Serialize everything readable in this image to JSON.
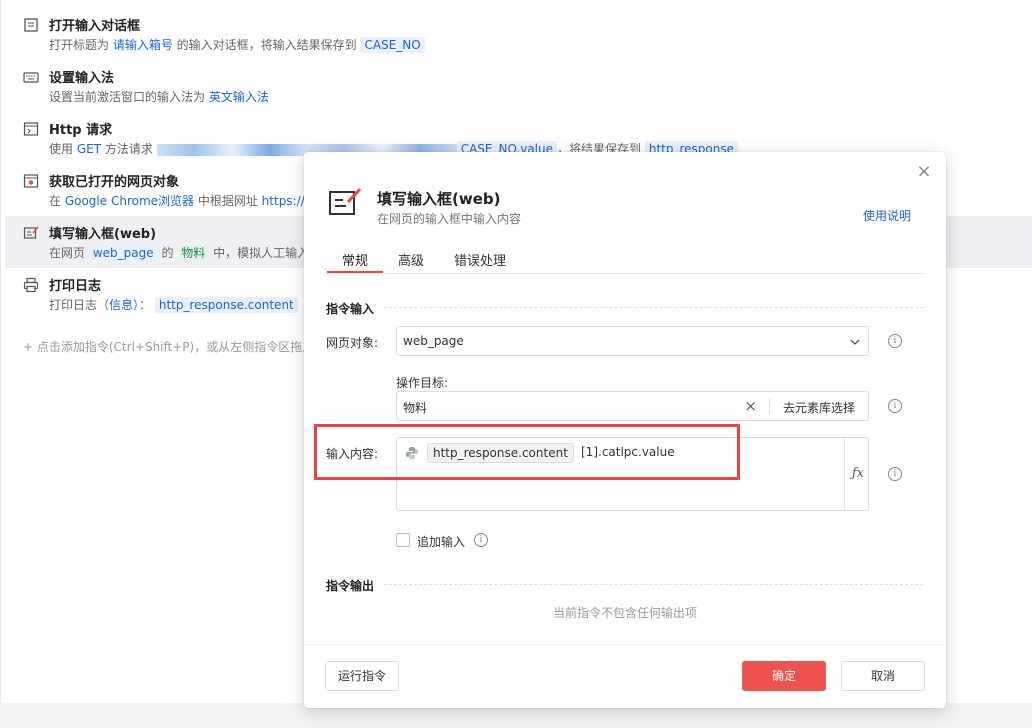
{
  "commands": [
    {
      "title": "打开输入对话框",
      "desc_a": "打开标题为 ",
      "desc_b": "请输入箱号",
      "desc_c": " 的输入对话框，将输入结果保存到 ",
      "desc_d": "CASE_NO"
    },
    {
      "title": "设置输入法",
      "desc_a": "设置当前激活窗口的输入法为 ",
      "desc_b": "英文输入法"
    },
    {
      "title": "Http 请求",
      "desc_a": "使用 ",
      "desc_b": "GET",
      "desc_c": " 方法请求 ",
      "desc_d": "CASE_NO.value",
      "desc_e": "，将结果保存到 ",
      "desc_f": "http_response"
    },
    {
      "title": "获取已打开的网页对象",
      "desc_a": "在 ",
      "desc_b": "Google Chrome浏览器",
      "desc_c": " 中根据网址 ",
      "desc_d": "https://"
    },
    {
      "title": "填写输入框(web)",
      "desc_a": "在网页 ",
      "desc_b": "web_page",
      "desc_c": " 的 ",
      "desc_d": "物料",
      "desc_e": " 中，模拟人工输入"
    },
    {
      "title": "打印日志",
      "desc_a": "打印日志（",
      "desc_b": "信息",
      "desc_c": "）： ",
      "desc_d": "http_response.content"
    }
  ],
  "add_hint": "+ 点击添加指令(Ctrl+Shift+P)，或从左侧指令区拖入",
  "modal": {
    "close": "×",
    "title": "填写输入框(web)",
    "subtitle": "在网页的输入框中输入内容",
    "help": "使用说明",
    "tabs": [
      "常规",
      "高级",
      "错误处理"
    ],
    "section_input": "指令输入",
    "web_object_label": "网页对象:",
    "web_object_value": "web_page",
    "target_label": "操作目标:",
    "target_value": "物料",
    "target_clear": "×",
    "target_pick": "去元素库选择",
    "content_label": "输入内容:",
    "content_chip": "http_response.content",
    "content_rest": "[1].catlpc.value",
    "fx": "ƒx",
    "append_label": "追加输入",
    "section_output": "指令输出",
    "no_output": "当前指令不包含任何输出项",
    "run_btn": "运行指令",
    "ok_btn": "确定",
    "cancel_btn": "取消"
  },
  "colors": {
    "accent": "#ef5350",
    "link": "#1a66d4",
    "highlight": "#e84646"
  }
}
